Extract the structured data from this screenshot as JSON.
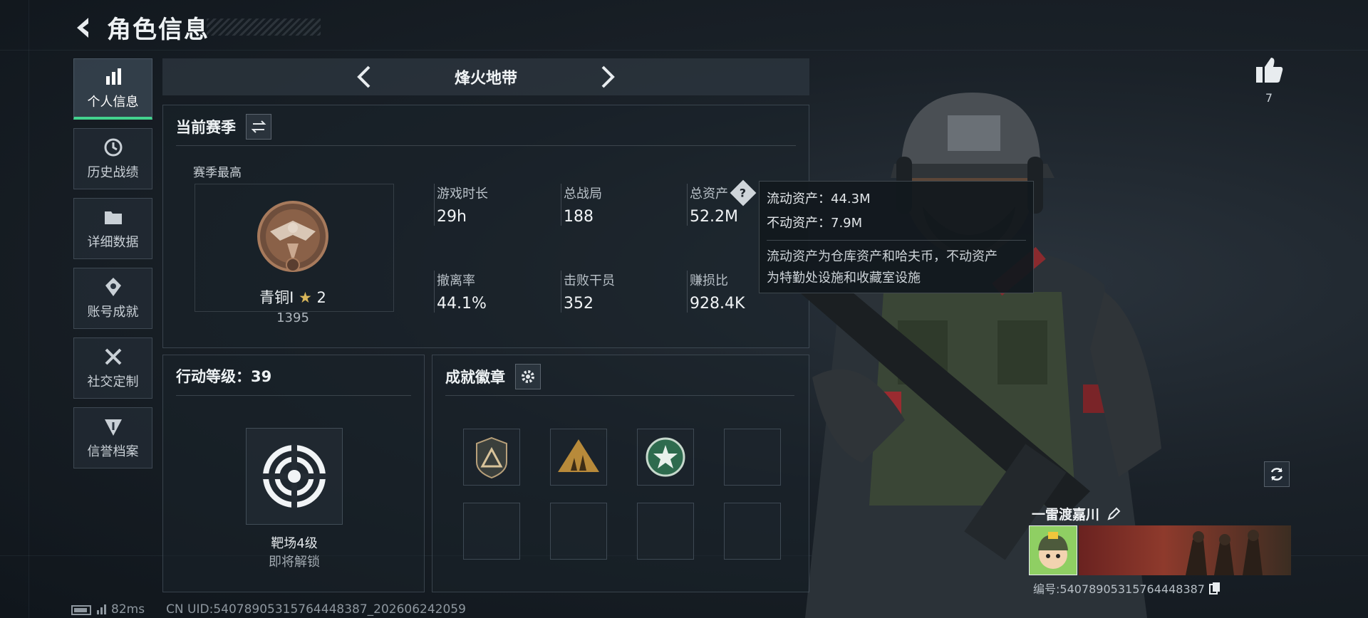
{
  "header": {
    "title": "角色信息"
  },
  "nav": [
    {
      "label": "个人信息",
      "icon": "bar-chart-icon",
      "active": true
    },
    {
      "label": "历史战绩",
      "icon": "history-icon",
      "active": false
    },
    {
      "label": "详细数据",
      "icon": "folder-icon",
      "active": false
    },
    {
      "label": "账号成就",
      "icon": "medal-icon",
      "active": false
    },
    {
      "label": "社交定制",
      "icon": "tools-icon",
      "active": false
    },
    {
      "label": "信誉档案",
      "icon": "shield-icon",
      "active": false
    }
  ],
  "mode": {
    "name": "烽火地带"
  },
  "season": {
    "title": "当前赛季",
    "best_label": "赛季最高",
    "rank_name": "青铜I",
    "rank_stars": "2",
    "rank_points": "1395",
    "stats": [
      {
        "label": "游戏时长",
        "value": "29h"
      },
      {
        "label": "总战局",
        "value": "188"
      },
      {
        "label": "总资产",
        "value": "52.2M"
      },
      {
        "label": "撤离率",
        "value": "44.1%"
      },
      {
        "label": "击败干员",
        "value": "352"
      },
      {
        "label": "赚损比",
        "value": "928.4K"
      }
    ]
  },
  "tooltip": {
    "liquid": "流动资产：44.3M",
    "fixed": "不动资产：7.9M",
    "desc_line1": "流动资产为仓库资产和哈夫币，不动资产",
    "desc_line2": "为特勤处设施和收藏室设施"
  },
  "action_level": {
    "title": "行动等级：39",
    "unlock_name": "靶场4级",
    "unlock_status": "即将解锁"
  },
  "achievements": {
    "title": "成就徽章"
  },
  "profile": {
    "likes": "7",
    "player_name": "一雷渡嘉川",
    "player_id": "编号:540789053157644483​87"
  },
  "footer": {
    "ping": "82ms",
    "uid": "CN UID:540789053157644483​87_202606242059"
  },
  "colors": {
    "accent_green": "#43d28e",
    "bronze": "#a77a5c"
  }
}
